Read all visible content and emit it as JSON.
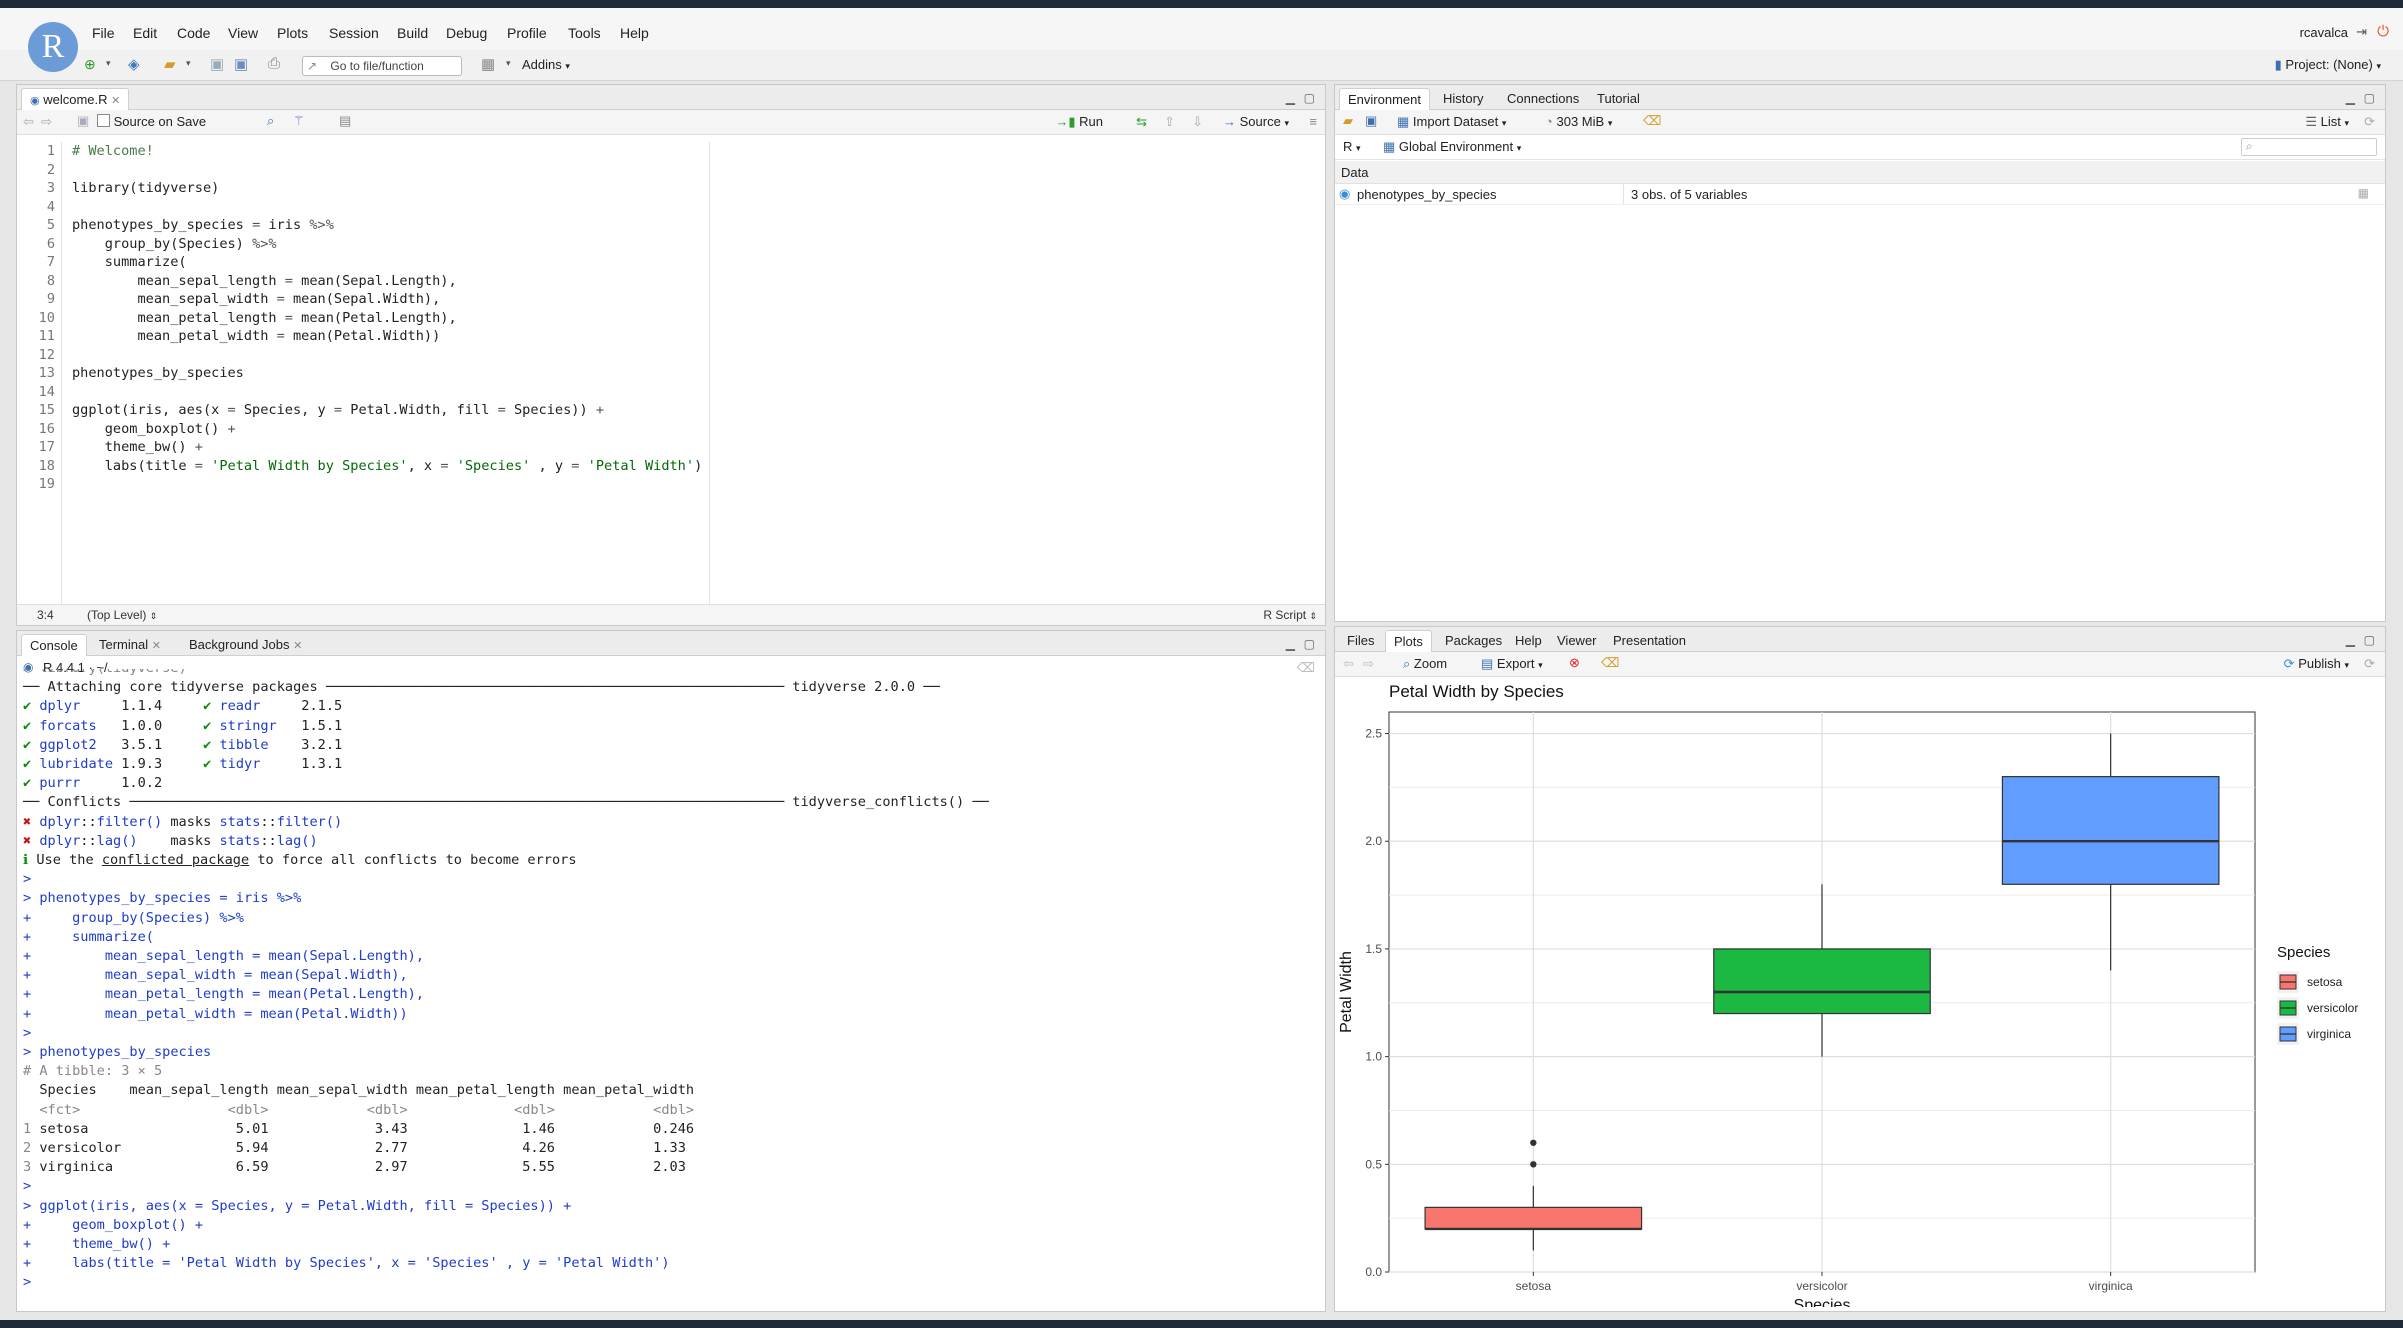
{
  "app": {
    "logo_letter": "R",
    "user": "rcavalca",
    "project": "Project: (None)",
    "menu": [
      "File",
      "Edit",
      "Code",
      "View",
      "Plots",
      "Session",
      "Build",
      "Debug",
      "Profile",
      "Tools",
      "Help"
    ],
    "goto_placeholder": "Go to file/function",
    "addins": "Addins"
  },
  "editor": {
    "tab": "welcome.R",
    "source_on_save": "Source on Save",
    "run": "Run",
    "source": "Source",
    "status_pos": "3:4",
    "status_scope": "(Top Level)",
    "status_type": "R Script",
    "lines": [
      {
        "n": "1",
        "parts": [
          [
            "cmt",
            "# Welcome!"
          ]
        ]
      },
      {
        "n": "2",
        "parts": []
      },
      {
        "n": "3",
        "parts": [
          [
            "txt",
            "library(tidyverse)"
          ]
        ]
      },
      {
        "n": "4",
        "parts": []
      },
      {
        "n": "5",
        "parts": [
          [
            "txt",
            "phenotypes_by_species "
          ],
          [
            "op",
            "= "
          ],
          [
            "txt",
            "iris "
          ],
          [
            "op",
            "%>%"
          ]
        ]
      },
      {
        "n": "6",
        "parts": [
          [
            "txt",
            "    group_by(Species) "
          ],
          [
            "op",
            "%>%"
          ]
        ]
      },
      {
        "n": "7",
        "parts": [
          [
            "txt",
            "    summarize("
          ]
        ]
      },
      {
        "n": "8",
        "parts": [
          [
            "txt",
            "        mean_sepal_length "
          ],
          [
            "op",
            "= "
          ],
          [
            "txt",
            "mean(Sepal.Length),"
          ]
        ]
      },
      {
        "n": "9",
        "parts": [
          [
            "txt",
            "        mean_sepal_width "
          ],
          [
            "op",
            "= "
          ],
          [
            "txt",
            "mean(Sepal.Width),"
          ]
        ]
      },
      {
        "n": "10",
        "parts": [
          [
            "txt",
            "        mean_petal_length "
          ],
          [
            "op",
            "= "
          ],
          [
            "txt",
            "mean(Petal.Length),"
          ]
        ]
      },
      {
        "n": "11",
        "parts": [
          [
            "txt",
            "        mean_petal_width "
          ],
          [
            "op",
            "= "
          ],
          [
            "txt",
            "mean(Petal.Width))"
          ]
        ]
      },
      {
        "n": "12",
        "parts": []
      },
      {
        "n": "13",
        "parts": [
          [
            "txt",
            "phenotypes_by_species"
          ]
        ]
      },
      {
        "n": "14",
        "parts": []
      },
      {
        "n": "15",
        "parts": [
          [
            "txt",
            "ggplot(iris, aes(x "
          ],
          [
            "op",
            "= "
          ],
          [
            "txt",
            "Species, y "
          ],
          [
            "op",
            "= "
          ],
          [
            "txt",
            "Petal.Width, fill "
          ],
          [
            "op",
            "= "
          ],
          [
            "txt",
            "Species)) "
          ],
          [
            "op",
            "+"
          ]
        ]
      },
      {
        "n": "16",
        "parts": [
          [
            "txt",
            "    geom_boxplot() "
          ],
          [
            "op",
            "+"
          ]
        ]
      },
      {
        "n": "17",
        "parts": [
          [
            "txt",
            "    theme_bw() "
          ],
          [
            "op",
            "+"
          ]
        ]
      },
      {
        "n": "18",
        "parts": [
          [
            "txt",
            "    labs(title "
          ],
          [
            "op",
            "= "
          ],
          [
            "str",
            "'Petal Width by Species'"
          ],
          [
            "txt",
            ", x "
          ],
          [
            "op",
            "= "
          ],
          [
            "str",
            "'Species'"
          ],
          [
            "txt",
            " , y "
          ],
          [
            "op",
            "= "
          ],
          [
            "str",
            "'Petal Width'"
          ],
          [
            "txt",
            ")"
          ]
        ]
      },
      {
        "n": "19",
        "parts": []
      }
    ]
  },
  "console": {
    "tabs": [
      "Console",
      "Terminal",
      "Background Jobs"
    ],
    "version": "R 4.4.1 · ~/",
    "lines": [
      [
        [
          "grey",
          "> library(tidyverse)"
        ]
      ],
      [
        [
          "txt",
          "── Attaching core tidyverse packages ──────────────────────────────────────────────────────── tidyverse 2.0.0 ──"
        ]
      ],
      [
        [
          "green",
          "✔ "
        ],
        [
          "pkg",
          "dplyr"
        ],
        [
          "txt",
          "     1.1.4     "
        ],
        [
          "green",
          "✔ "
        ],
        [
          "pkg",
          "readr"
        ],
        [
          "txt",
          "     2.1.5"
        ]
      ],
      [
        [
          "green",
          "✔ "
        ],
        [
          "pkg",
          "forcats"
        ],
        [
          "txt",
          "   1.0.0     "
        ],
        [
          "green",
          "✔ "
        ],
        [
          "pkg",
          "stringr"
        ],
        [
          "txt",
          "   1.5.1"
        ]
      ],
      [
        [
          "green",
          "✔ "
        ],
        [
          "pkg",
          "ggplot2"
        ],
        [
          "txt",
          "   3.5.1     "
        ],
        [
          "green",
          "✔ "
        ],
        [
          "pkg",
          "tibble"
        ],
        [
          "txt",
          "    3.2.1"
        ]
      ],
      [
        [
          "green",
          "✔ "
        ],
        [
          "pkg",
          "lubridate"
        ],
        [
          "txt",
          " 1.9.3     "
        ],
        [
          "green",
          "✔ "
        ],
        [
          "pkg",
          "tidyr"
        ],
        [
          "txt",
          "     1.3.1"
        ]
      ],
      [
        [
          "green",
          "✔ "
        ],
        [
          "pkg",
          "purrr"
        ],
        [
          "txt",
          "     1.0.2"
        ]
      ],
      [
        [
          "txt",
          "── Conflicts ──────────────────────────────────────────────────────────────────────────────── tidyverse_conflicts() ──"
        ]
      ],
      [
        [
          "red",
          "✖ "
        ],
        [
          "pkg",
          "dplyr"
        ],
        [
          "txt",
          "::"
        ],
        [
          "pkg",
          "filter()"
        ],
        [
          "txt",
          " masks "
        ],
        [
          "pkg",
          "stats"
        ],
        [
          "txt",
          "::"
        ],
        [
          "pkg",
          "filter()"
        ]
      ],
      [
        [
          "red",
          "✖ "
        ],
        [
          "pkg",
          "dplyr"
        ],
        [
          "txt",
          "::"
        ],
        [
          "pkg",
          "lag()"
        ],
        [
          "txt",
          "    masks "
        ],
        [
          "pkg",
          "stats"
        ],
        [
          "txt",
          "::"
        ],
        [
          "pkg",
          "lag()"
        ]
      ],
      [
        [
          "green",
          "ℹ "
        ],
        [
          "txt",
          "Use the "
        ],
        [
          "ul",
          "conflicted package"
        ],
        [
          "txt",
          " to force all conflicts to become errors"
        ]
      ],
      [
        [
          "blue",
          ">"
        ]
      ],
      [
        [
          "blue",
          "> phenotypes_by_species = iris %>%"
        ]
      ],
      [
        [
          "blue",
          "+     group_by(Species) %>%"
        ]
      ],
      [
        [
          "blue",
          "+     summarize("
        ]
      ],
      [
        [
          "blue",
          "+         mean_sepal_length = mean(Sepal.Length),"
        ]
      ],
      [
        [
          "blue",
          "+         mean_sepal_width = mean(Sepal.Width),"
        ]
      ],
      [
        [
          "blue",
          "+         mean_petal_length = mean(Petal.Length),"
        ]
      ],
      [
        [
          "blue",
          "+         mean_petal_width = mean(Petal.Width))"
        ]
      ],
      [
        [
          "blue",
          ">"
        ]
      ],
      [
        [
          "blue",
          "> phenotypes_by_species"
        ]
      ],
      [
        [
          "grey",
          "# A tibble: 3 × 5"
        ]
      ],
      [
        [
          "txt",
          "  Species    mean_sepal_length mean_sepal_width mean_petal_length mean_petal_width"
        ]
      ],
      [
        [
          "grey",
          "  <fct>                  <dbl>            <dbl>             <dbl>            <dbl>"
        ]
      ],
      [
        [
          "grey",
          "1 "
        ],
        [
          "txt",
          "setosa                  5.01             3.43              1.46            0.246"
        ]
      ],
      [
        [
          "grey",
          "2 "
        ],
        [
          "txt",
          "versicolor              5.94             2.77              4.26            1.33 "
        ]
      ],
      [
        [
          "grey",
          "3 "
        ],
        [
          "txt",
          "virginica               6.59             2.97              5.55            2.03 "
        ]
      ],
      [
        [
          "blue",
          ">"
        ]
      ],
      [
        [
          "blue",
          "> ggplot(iris, aes(x = Species, y = Petal.Width, fill = Species)) +"
        ]
      ],
      [
        [
          "blue",
          "+     geom_boxplot() +"
        ]
      ],
      [
        [
          "blue",
          "+     theme_bw() +"
        ]
      ],
      [
        [
          "blue",
          "+     labs(title = 'Petal Width by Species', x = 'Species' , y = 'Petal Width')"
        ]
      ],
      [
        [
          "blue",
          "> "
        ]
      ]
    ]
  },
  "environment": {
    "tabs": [
      "Environment",
      "History",
      "Connections",
      "Tutorial"
    ],
    "import_dataset": "Import Dataset",
    "memory": "303 MiB",
    "list_view": "List",
    "lang": "R",
    "scope": "Global Environment",
    "section": "Data",
    "rows": [
      {
        "name": "phenotypes_by_species",
        "value": "3 obs. of 5 variables"
      }
    ]
  },
  "files": {
    "tabs": [
      "Files",
      "Plots",
      "Packages",
      "Help",
      "Viewer",
      "Presentation"
    ],
    "zoom": "Zoom",
    "export": "Export",
    "publish": "Publish"
  },
  "chart_data": {
    "type": "box",
    "title": "Petal Width by Species",
    "xlabel": "Species",
    "ylabel": "Petal Width",
    "categories": [
      "setosa",
      "versicolor",
      "virginica"
    ],
    "ylim": [
      0.0,
      2.6
    ],
    "yticks": [
      "0.0",
      "0.5",
      "1.0",
      "1.5",
      "2.0",
      "2.5"
    ],
    "boxes": [
      {
        "name": "setosa",
        "lower_whisker": 0.1,
        "q1": 0.2,
        "median": 0.2,
        "q3": 0.3,
        "upper_whisker": 0.4,
        "outliers": [
          0.5,
          0.6
        ],
        "color": "#f8766d"
      },
      {
        "name": "versicolor",
        "lower_whisker": 1.0,
        "q1": 1.2,
        "median": 1.3,
        "q3": 1.5,
        "upper_whisker": 1.8,
        "outliers": [],
        "color": "#1bb842"
      },
      {
        "name": "virginica",
        "lower_whisker": 1.4,
        "q1": 1.8,
        "median": 2.0,
        "q3": 2.3,
        "upper_whisker": 2.5,
        "outliers": [],
        "color": "#619cff"
      }
    ],
    "legend": {
      "title": "Species",
      "placement": "right",
      "entries": [
        "setosa",
        "versicolor",
        "virginica"
      ]
    },
    "grid": true
  }
}
